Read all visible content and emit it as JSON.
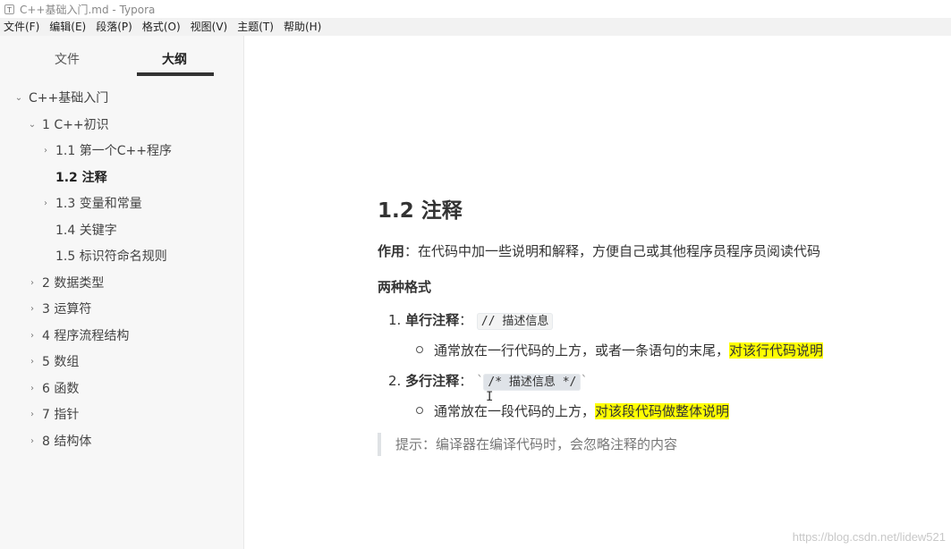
{
  "window": {
    "title": "C++基础入门.md - Typora",
    "app_icon": "T"
  },
  "menubar": [
    "文件(F)",
    "编辑(E)",
    "段落(P)",
    "格式(O)",
    "视图(V)",
    "主题(T)",
    "帮助(H)"
  ],
  "sidebar": {
    "tabs": {
      "files": "文件",
      "outline": "大纲",
      "active": "outline"
    },
    "outline": [
      {
        "label": "C++基础入门",
        "expanded": true
      },
      {
        "label": "1 C++初识",
        "expanded": true
      },
      {
        "label": "1.1 第一个C++程序",
        "expanded": false
      },
      {
        "label": "1.2 注释",
        "active": true
      },
      {
        "label": "1.3 变量和常量",
        "expanded": false
      },
      {
        "label": "1.4 关键字"
      },
      {
        "label": "1.5 标识符命名规则"
      },
      {
        "label": "2 数据类型",
        "expanded": false
      },
      {
        "label": "3 运算符",
        "expanded": false
      },
      {
        "label": "4 程序流程结构",
        "expanded": false
      },
      {
        "label": "5 数组",
        "expanded": false
      },
      {
        "label": "6 函数",
        "expanded": false
      },
      {
        "label": "7 指针",
        "expanded": false
      },
      {
        "label": "8 结构体",
        "expanded": false
      }
    ]
  },
  "document": {
    "heading": "1.2 注释",
    "purpose_label": "作用",
    "purpose_text": "：在代码中加一些说明和解释，方便自己或其他程序员程序员阅读代码",
    "formats_heading": "两种格式",
    "list": [
      {
        "num": "1.",
        "label": "单行注释",
        "colon": "：",
        "code": "// 描述信息",
        "sub_text": "通常放在一行代码的上方，或者一条语句的末尾，",
        "sub_highlight": "对该行代码说明"
      },
      {
        "num": "2.",
        "label": "多行注释",
        "colon": "：",
        "backtick": "`",
        "code": "/* 描述信息 */",
        "sub_text": "通常放在一段代码的上方，",
        "sub_highlight": "对该段代码做整体说明"
      }
    ],
    "blockquote": "提示：编译器在编译代码时，会忽略注释的内容"
  },
  "watermark": "https://blog.csdn.net/lidew521",
  "colors": {
    "highlight": "#ffff00",
    "sidebar_bg": "#f7f7f7",
    "menubar_bg": "#f2f2f2"
  }
}
